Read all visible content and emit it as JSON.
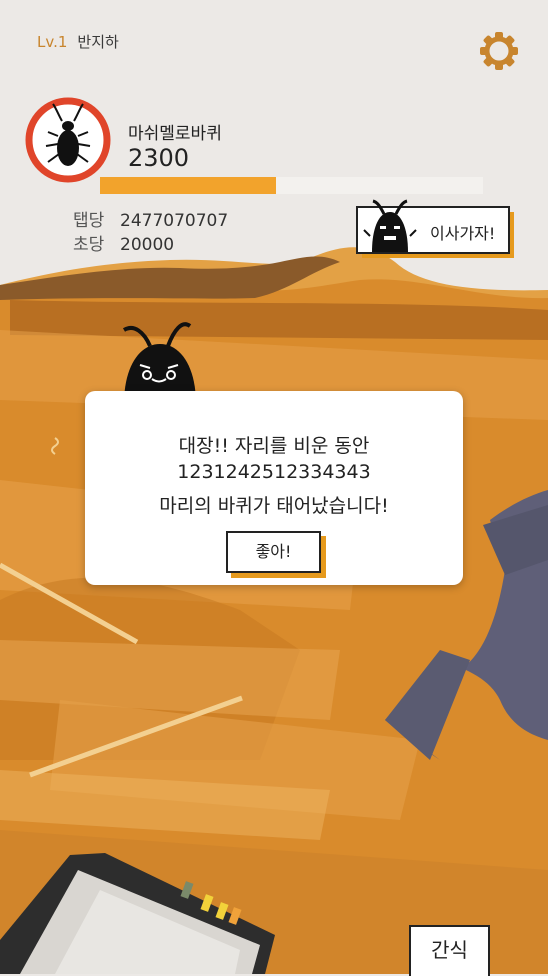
{
  "header": {
    "level": "Lv.1",
    "location": "반지하"
  },
  "icons": {
    "settings": "gear-icon",
    "avatar": "cockroach-icon",
    "move_character": "cockroach-face-icon",
    "peeking_character": "cockroach-peek-icon"
  },
  "colors": {
    "accent": "#e69a1d",
    "level_text": "#c8852e",
    "avatar_ring": "#e0452a",
    "progress_fill": "#f2a32c",
    "floor": "#d98b2c"
  },
  "bug": {
    "name": "마쉬멜로바퀴",
    "count": "2300",
    "progress_fraction": 0.46
  },
  "stats": {
    "tap_label": "탭당",
    "tap_value": "2477070707",
    "sec_label": "초당",
    "sec_value": "20000"
  },
  "move_button": {
    "label": "이사가자!"
  },
  "dialog": {
    "line1": "대장!! 자리를 비운 동안",
    "line2": "1231242512334343",
    "line3": "마리의 바퀴가 태어났습니다!",
    "ok_label": "좋아!"
  },
  "snack_button": {
    "label": "간식"
  }
}
